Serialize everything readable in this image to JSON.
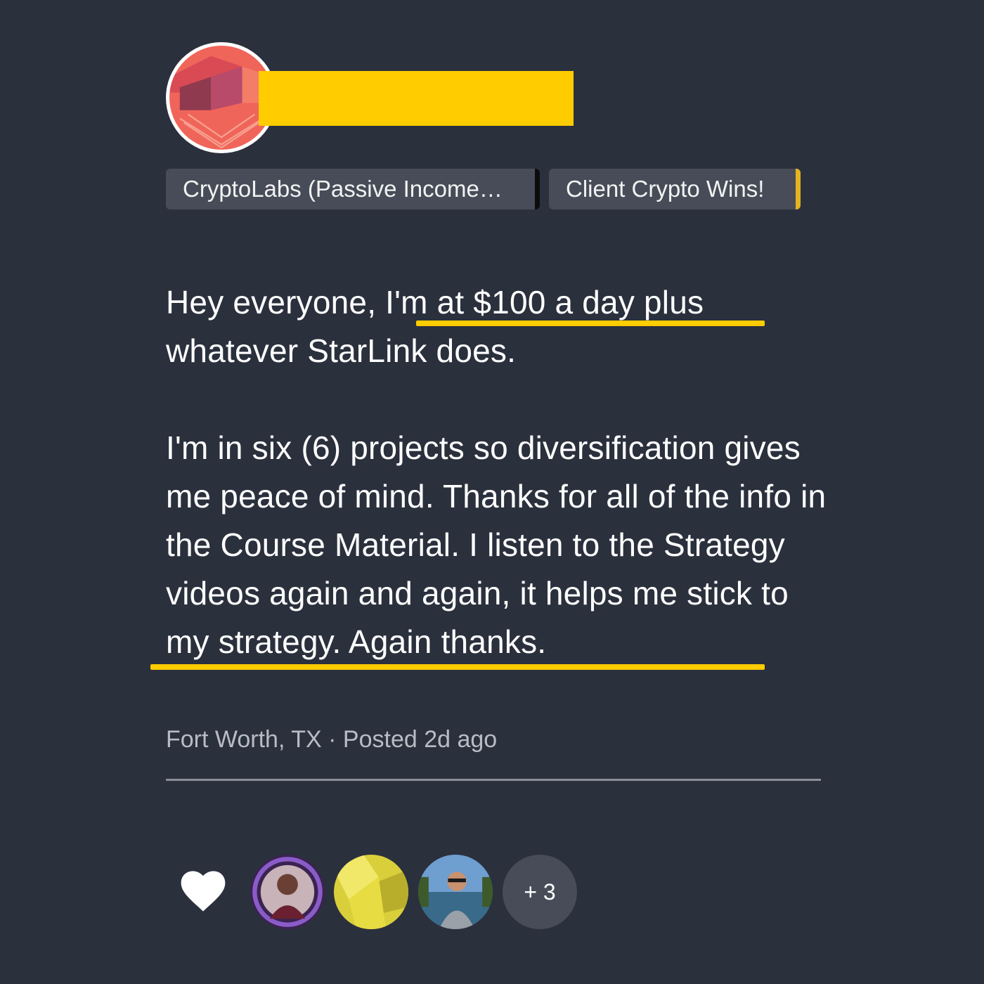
{
  "tags": [
    {
      "label": "CryptoLabs (Passive Income…"
    },
    {
      "label": "Client Crypto Wins!"
    }
  ],
  "post": {
    "line_1": "Hey everyone, I'm at $100 a day plus",
    "line_2": "whatever StarLink does.",
    "paragraph_2": "I'm in six (6) projects so diversification gives me peace of mind. Thanks for all of the info in the Course Material. I listen to the Strategy videos again and again, it helps me stick to my strategy. Again thanks."
  },
  "meta": {
    "location": "Fort Worth, TX",
    "separator": "·",
    "posted": "Posted 2d ago"
  },
  "reactions": {
    "more_count": "+ 3"
  },
  "colors": {
    "background": "#2b303d",
    "highlight": "#ffcc00",
    "tag_background": "#474c58"
  },
  "icons": {
    "like": "heart-icon"
  }
}
